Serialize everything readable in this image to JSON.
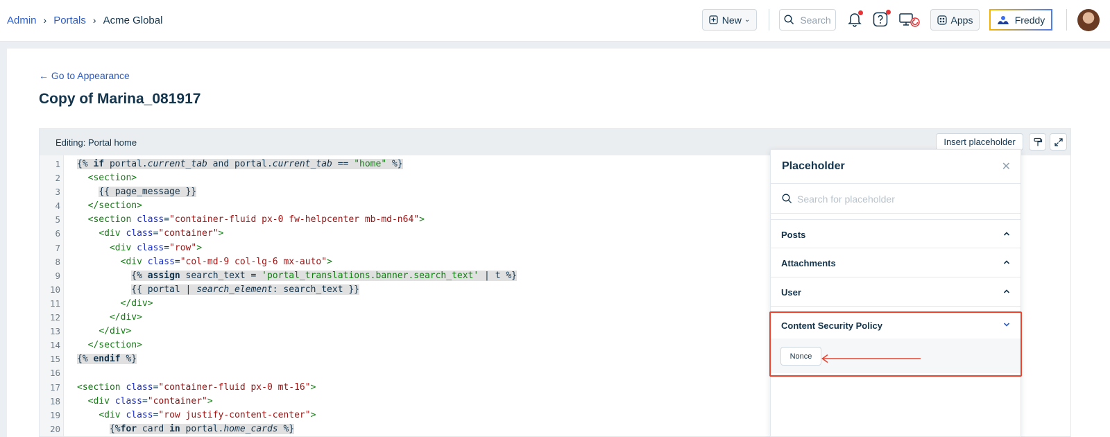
{
  "breadcrumb": {
    "items": [
      "Admin",
      "Portals"
    ],
    "current": "Acme Global"
  },
  "topbar": {
    "new_label": "New",
    "search_placeholder": "Search",
    "apps_label": "Apps",
    "freddy_label": "Freddy"
  },
  "page": {
    "back_link": "← Go to Appearance",
    "title": "Copy of Marina_081917"
  },
  "editor": {
    "title": "Editing: Portal home",
    "insert_placeholder_label": "Insert placeholder",
    "line_numbers": [
      "1",
      "2",
      "3",
      "4",
      "5",
      "6",
      "7",
      "8",
      "9",
      "10",
      "11",
      "12",
      "13",
      "14",
      "15",
      "16",
      "17",
      "18",
      "19",
      "20"
    ]
  },
  "placeholder_panel": {
    "title": "Placeholder",
    "search_placeholder": "Search for placeholder",
    "sections": [
      {
        "label": "Posts",
        "expanded": false
      },
      {
        "label": "Attachments",
        "expanded": false
      },
      {
        "label": "User",
        "expanded": false
      },
      {
        "label": "Content Security Policy",
        "expanded": true
      }
    ],
    "csp_items": [
      "Nonce"
    ]
  },
  "colors": {
    "link": "#2c5cc5",
    "highlight_border": "#e8432f",
    "text_dark": "#12344d"
  }
}
